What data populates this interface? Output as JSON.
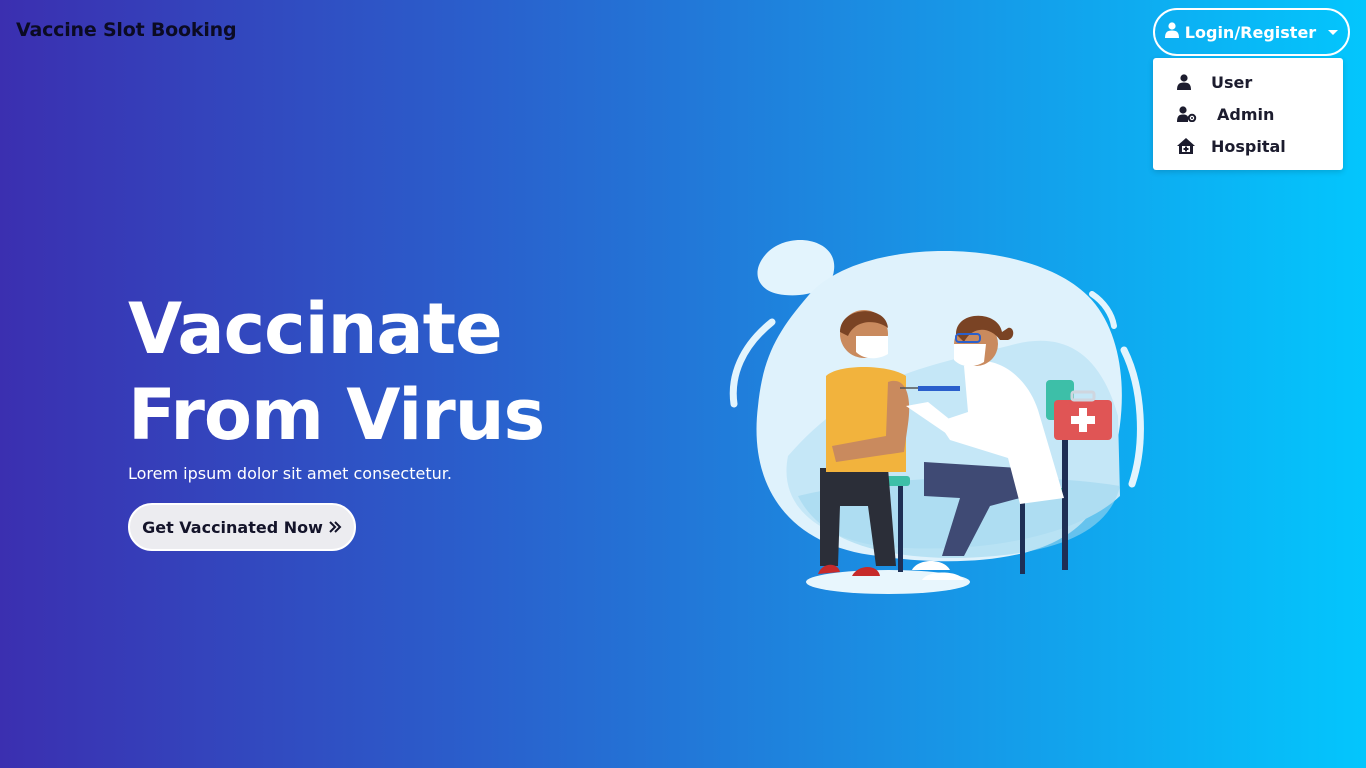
{
  "brand": {
    "name": "Vaccine Slot Booking"
  },
  "nav": {
    "login_label": "Login/Register",
    "dropdown": [
      {
        "label": "User",
        "icon": "user-icon"
      },
      {
        "label": "Admin",
        "icon": "user-gear-icon"
      },
      {
        "label": "Hospital",
        "icon": "hospital-house-icon"
      }
    ]
  },
  "hero": {
    "title_line1": "Vaccinate",
    "title_line2": "From Virus",
    "subtitle": "Lorem ipsum dolor sit amet consectetur.",
    "cta_label": "Get Vaccinated Now",
    "cta_icon": "double-chevron-right-icon"
  },
  "colors": {
    "gradient_start": "#3b2fb0",
    "gradient_end": "#03c6fd",
    "brand_text": "#0b0b23",
    "cta_bg": "#ececf0"
  }
}
